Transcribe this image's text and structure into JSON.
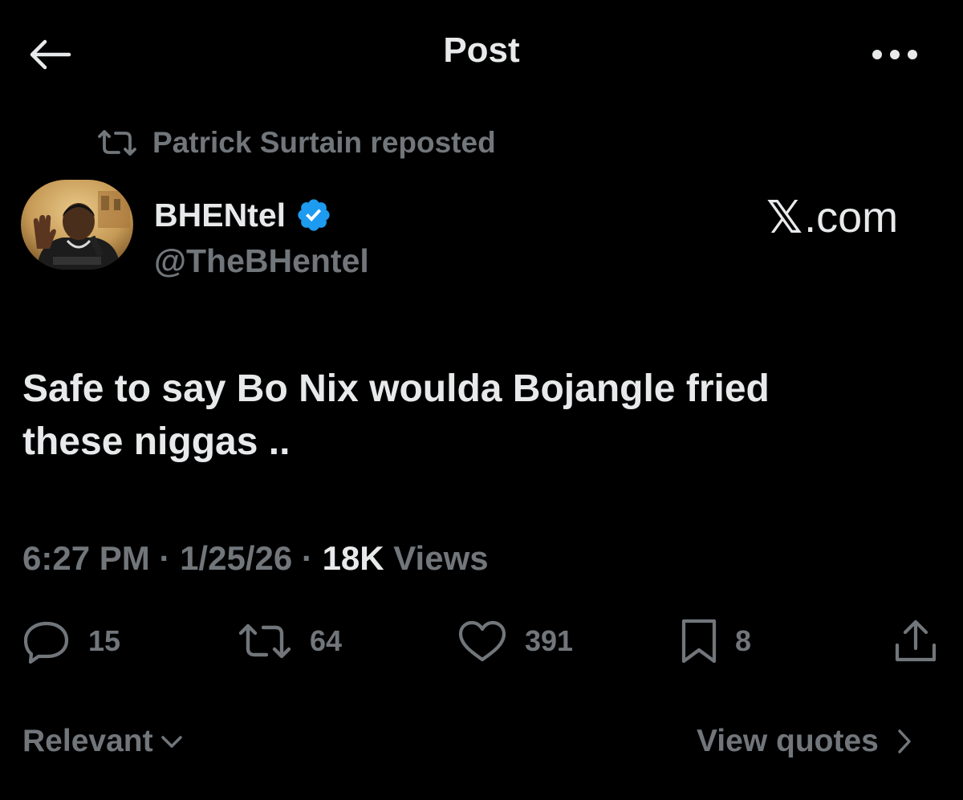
{
  "header": {
    "title": "Post"
  },
  "repost": {
    "text": "Patrick Surtain reposted"
  },
  "author": {
    "name": "BHENtel",
    "handle": "@TheBHentel",
    "source_label": ".com",
    "source_mark": "𝕏"
  },
  "post": {
    "text": "Safe to say Bo Nix woulda Bojangle fried\nthese niggas .."
  },
  "meta": {
    "time": "6:27 PM",
    "separator": "·",
    "date": "1/25/26",
    "views_count": "18K",
    "views_label": "Views"
  },
  "actions": {
    "replies": "15",
    "reposts": "64",
    "likes": "391",
    "bookmarks": "8"
  },
  "footer": {
    "sort_label": "Relevant",
    "quotes_label": "View quotes"
  },
  "colors": {
    "background": "#000000",
    "primary_text": "#e7e9ea",
    "secondary_text": "#71767b",
    "verified_badge": "#1d9bf0"
  },
  "icons": {
    "back": "arrow-left-icon",
    "more": "more-horizontal-icon",
    "repost": "repost-icon",
    "verified": "verified-badge-icon",
    "reply": "reply-icon",
    "like": "heart-icon",
    "bookmark": "bookmark-icon",
    "share": "share-icon",
    "chevron_down": "chevron-down-icon",
    "chevron_right": "chevron-right-icon"
  }
}
